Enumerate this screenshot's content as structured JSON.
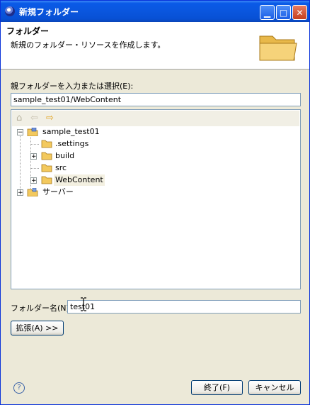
{
  "window": {
    "title": "新規フォルダー"
  },
  "header": {
    "title": "フォルダー",
    "description": "新規のフォルダー・リソースを作成します。"
  },
  "parent": {
    "label": "親フォルダーを入力または選択(E):",
    "value": "sample_test01/WebContent"
  },
  "tree": {
    "nodes": [
      {
        "label": "sample_test01",
        "icon": "project-icon"
      },
      {
        "label": ".settings",
        "icon": "folder-icon"
      },
      {
        "label": "build",
        "icon": "folder-icon"
      },
      {
        "label": "src",
        "icon": "folder-icon"
      },
      {
        "label": "WebContent",
        "icon": "folder-icon"
      },
      {
        "label": "サーバー",
        "icon": "servers-project-icon"
      }
    ]
  },
  "folder_name": {
    "label": "フォルダー名(N):",
    "value": "test01"
  },
  "advanced_button": "拡張(A) >>",
  "finish_button": "終了(F)",
  "cancel_button": "キャンセル",
  "help_symbol": "?"
}
